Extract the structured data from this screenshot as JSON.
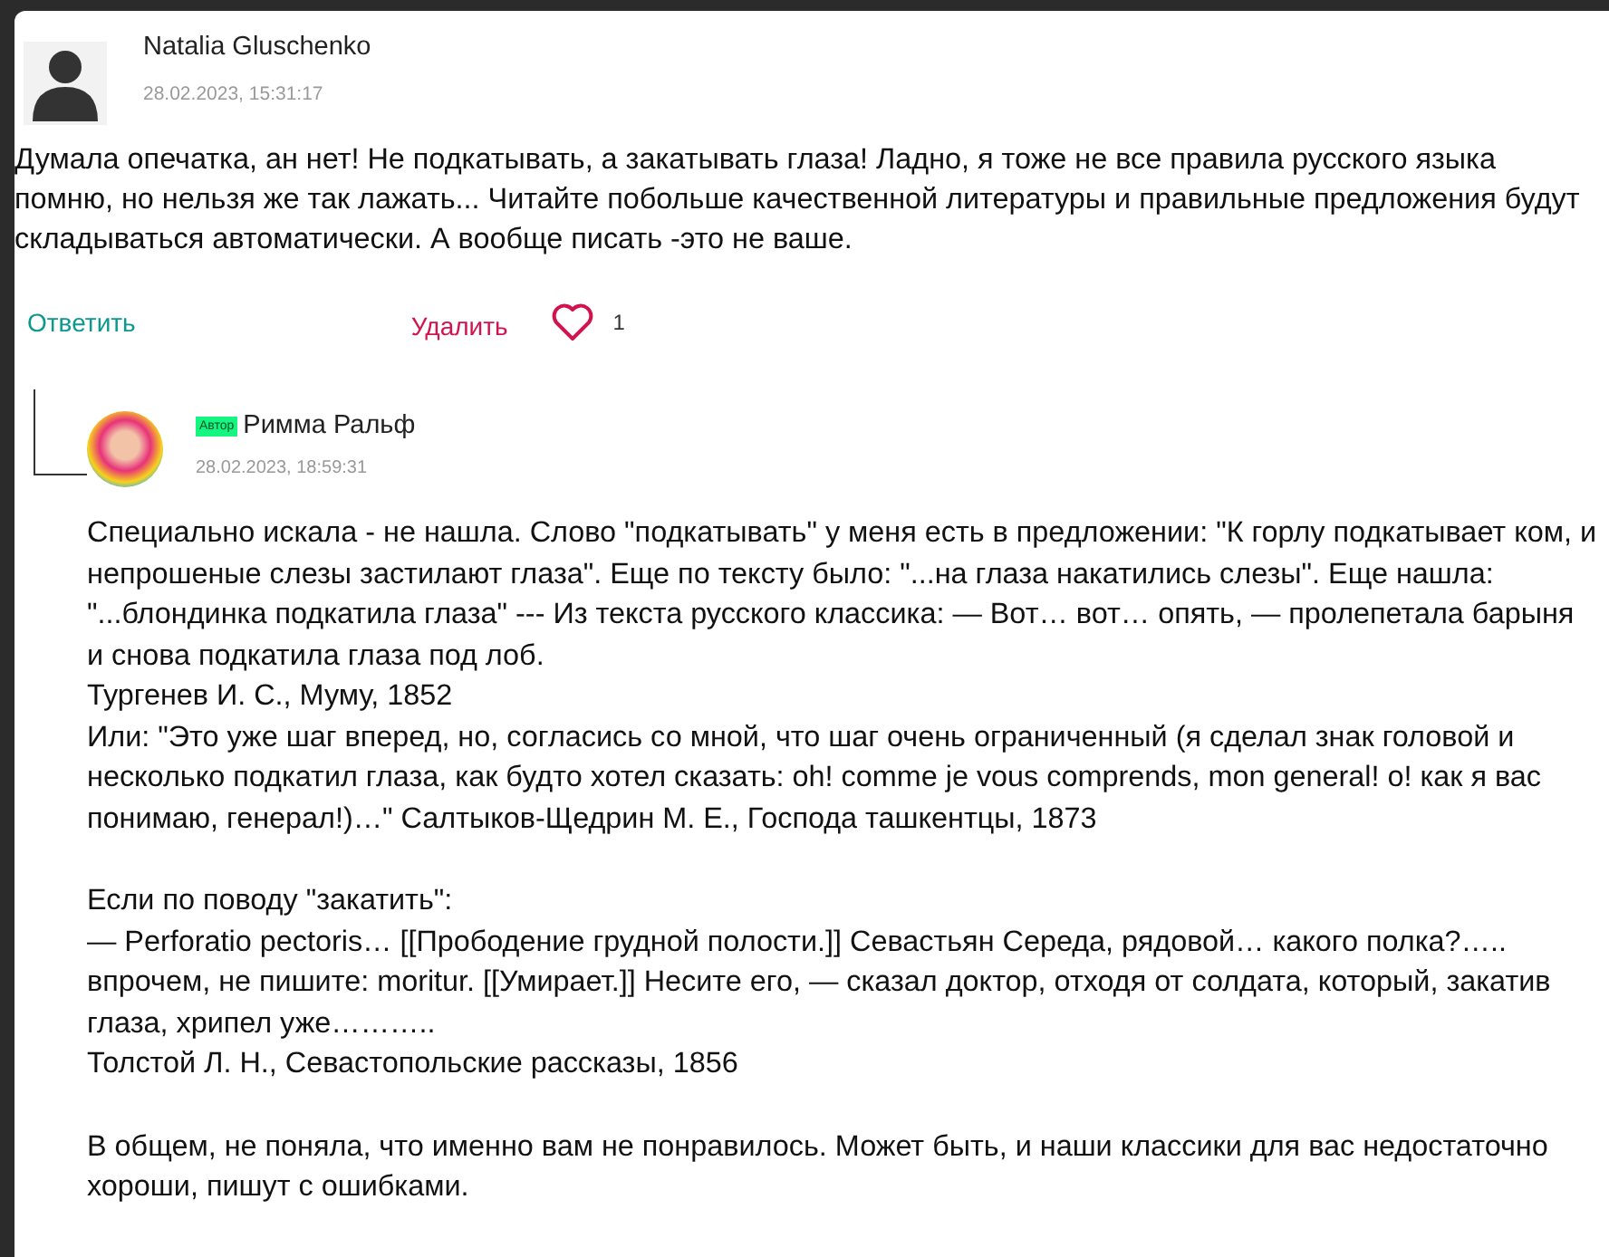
{
  "comment": {
    "author": "Natalia Gluschenko",
    "date": "28.02.2023, 15:31:17",
    "text": "Думала опечатка, ан нет! Не подкатывать, а закатывать глаза! Ладно, я тоже не все правила русского языка помню, но нельзя же так лажать... Читайте побольше качественной литературы и правильные предложения будут складываться автоматически. А вообще писать -это не ваше.",
    "reply_label": "Ответить",
    "delete_label": "Удалить",
    "likes": "1"
  },
  "reply": {
    "badge": "Автор",
    "author": "Римма Ральф",
    "date": "28.02.2023, 18:59:31",
    "paragraphs": [
      [
        "Специально искала - не нашла. Слово \"подкатывать\" у меня есть в предложении: \"К горлу подкатывает ком, и непрошеные слезы застилают глаза\". Еще по тексту было: \"...на глаза накатились слезы\". Еще нашла: \"...блондинка подкатила глаза\" --- Из текста русского классика: — Вот… вот… опять, — пролепетала барыня и снова подкатила глаза под лоб.",
        "Тургенев И. С., Муму, 1852",
        "Или: \"Это уже шаг вперед, но, согласись со мной, что шаг очень ограниченный (я сделал знак головой и несколько подкатил глаза, как будто хотел сказать: oh! comme je vous comprends, mon general! o! как я вас понимаю, генерал!)…\" Салтыков-Щедрин М. Е., Господа ташкентцы, 1873"
      ],
      [
        "Если по поводу \"закатить\":",
        "— Perforatio pectoris… [[Прободение грудной полости.]] Севастьян Середа, рядовой… какого полка?….. впрочем, не пишите: moritur. [[Умирает.]] Несите его, — сказал доктор, отходя от солдата, который, закатив глаза, хрипел уже………..",
        "Толстой Л. Н., Севастопольские рассказы, 1856"
      ],
      [
        "В общем, не поняла, что именно вам не понравилось. Может быть, и наши классики для вас недостаточно хороши, пишут с ошибками."
      ]
    ]
  }
}
